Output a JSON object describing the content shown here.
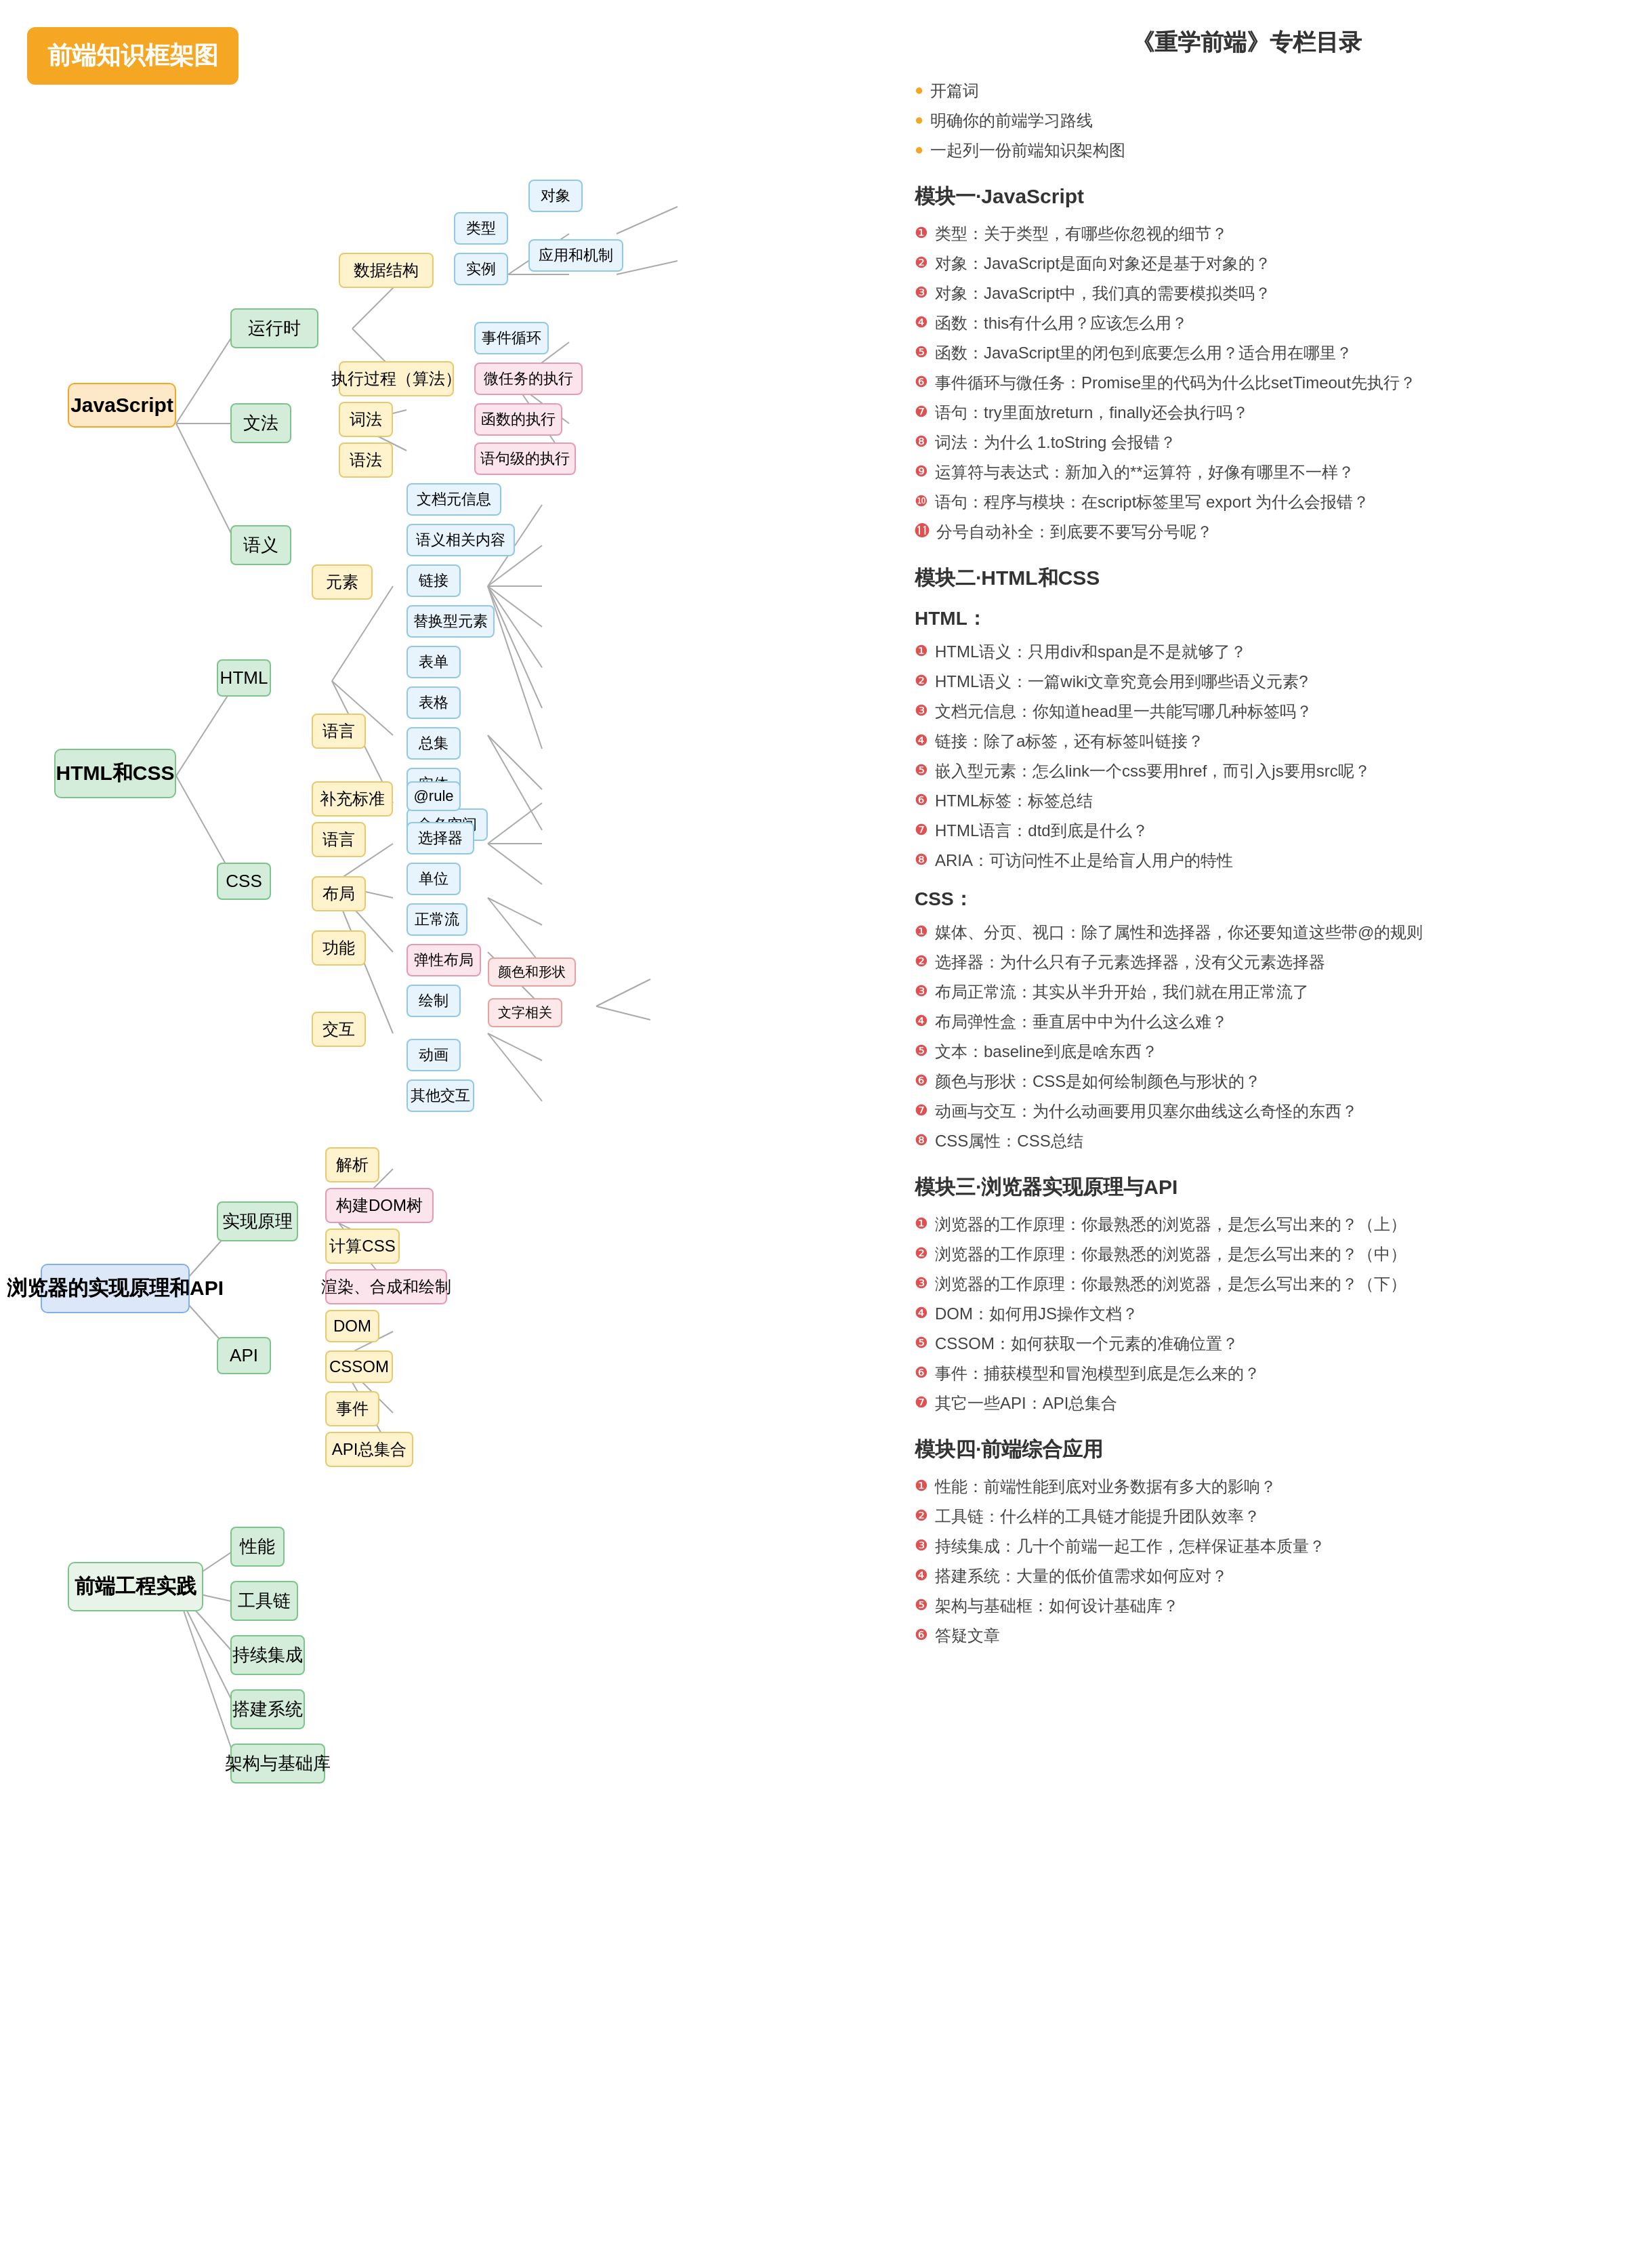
{
  "left": {
    "title": "前端知识框架图",
    "nodes": {
      "js": "JavaScript",
      "html_css": "HTML和CSS",
      "browser": "浏览器的实现原理和API",
      "engineering": "前端工程实践",
      "js_runtime": "运行时",
      "js_syntax": "文法",
      "js_semantic": "语义",
      "js_data": "数据结构",
      "js_type": "类型",
      "js_object": "对象",
      "js_instance": "实例",
      "js_app": "应用和机制",
      "js_event_loop": "事件循环",
      "js_exec": "执行过程（算法）",
      "js_micro": "微任务的执行",
      "js_func": "函数的执行",
      "js_stmt": "语句级的执行",
      "js_lexical": "词法",
      "js_grammar": "语法",
      "html_node": "HTML",
      "css_node": "CSS",
      "html_element": "元素",
      "html_lang": "语言",
      "html_supplement": "补充标准",
      "html_meta": "文档元信息",
      "html_semantic": "语义相关内容",
      "html_link": "链接",
      "html_replace": "替换型元素",
      "html_form": "表单",
      "html_table": "表格",
      "html_collection": "总集",
      "html_entity": "实体",
      "html_namespace": "命名空间",
      "css_lang": "语言",
      "css_layout": "布局",
      "css_func": "功能",
      "css_interact": "交互",
      "css_atrule": "@rule",
      "css_selector": "选择器",
      "css_unit": "单位",
      "css_normal": "正常流",
      "css_flex": "弹性布局",
      "css_draw": "绘制",
      "css_color": "颜色和形状",
      "css_text": "文字相关",
      "css_animation": "动画",
      "css_other": "其他交互",
      "browser_impl": "实现原理",
      "browser_api": "API",
      "browser_parse": "解析",
      "browser_dom_tree": "构建DOM树",
      "browser_css": "计算CSS",
      "browser_render": "渲染、合成和绘制",
      "browser_dom": "DOM",
      "browser_cssom": "CSSOM",
      "browser_event": "事件",
      "browser_api_all": "API总集合",
      "eng_perf": "性能",
      "eng_tools": "工具链",
      "eng_ci": "持续集成",
      "eng_build": "搭建系统",
      "eng_arch": "架构与基础库"
    }
  },
  "right": {
    "main_title": "《重学前端》专栏目录",
    "intro_items": [
      "开篇词",
      "明确你的前端学习路线",
      "一起列一份前端知识架构图"
    ],
    "module1_title": "模块一·JavaScript",
    "module1_items": [
      "类型：关于类型，有哪些你忽视的细节？",
      "对象：JavaScript是面向对象还是基于对象的？",
      "对象：JavaScript中，我们真的需要模拟类吗？",
      "函数：this有什么用？应该怎么用？",
      "函数：JavaScript里的闭包到底要怎么用？适合用在哪里？",
      "事件循环与微任务：Promise里的代码为什么比setTimeout先执行？",
      "语句：try里面放return，finally还会执行吗？",
      "词法：为什么 1.toString 会报错？",
      "运算符与表达式：新加入的**运算符，好像有哪里不一样？",
      "语句：程序与模块：在script标签里写 export 为什么会报错？",
      "分号自动补全：到底要不要写分号呢？"
    ],
    "module2_title": "模块二·HTML和CSS",
    "html_subtitle": "HTML：",
    "html_items": [
      "HTML语义：只用div和span是不是就够了？",
      "HTML语义：一篇wiki文章究竟会用到哪些语义元素?",
      "文档元信息：你知道head里一共能写哪几种标签吗？",
      "链接：除了a标签，还有标签叫链接？",
      "嵌入型元素：怎么link一个css要用href，而引入js要用src呢？",
      "HTML标签：标签总结",
      "HTML语言：dtd到底是什么？",
      "ARIA：可访问性不止是给盲人用户的特性"
    ],
    "css_subtitle": "CSS：",
    "css_items": [
      "媒体、分页、视口：除了属性和选择器，你还要知道这些带@的规则",
      "选择器：为什么只有子元素选择器，没有父元素选择器",
      "布局正常流：其实从半升开始，我们就在用正常流了",
      "布局弹性盒：垂直居中中为什么这么难？",
      "文本：baseline到底是啥东西？",
      "颜色与形状：CSS是如何绘制颜色与形状的？",
      "动画与交互：为什么动画要用贝塞尔曲线这么奇怪的东西？",
      "CSS属性：CSS总结"
    ],
    "module3_title": "模块三·浏览器实现原理与API",
    "module3_items": [
      "浏览器的工作原理：你最熟悉的浏览器，是怎么写出来的？（上）",
      "浏览器的工作原理：你最熟悉的浏览器，是怎么写出来的？（中）",
      "浏览器的工作原理：你最熟悉的浏览器，是怎么写出来的？（下）",
      "DOM：如何用JS操作文档？",
      "CSSOM：如何获取一个元素的准确位置？",
      "事件：捕获模型和冒泡模型到底是怎么来的？",
      "其它一些API：API总集合"
    ],
    "module4_title": "模块四·前端综合应用",
    "module4_items": [
      "性能：前端性能到底对业务数据有多大的影响？",
      "工具链：什么样的工具链才能提升团队效率？",
      "持续集成：几十个前端一起工作，怎样保证基本质量？",
      "搭建系统：大量的低价值需求如何应对？",
      "架构与基础框：如何设计基础库？",
      "答疑文章"
    ]
  }
}
